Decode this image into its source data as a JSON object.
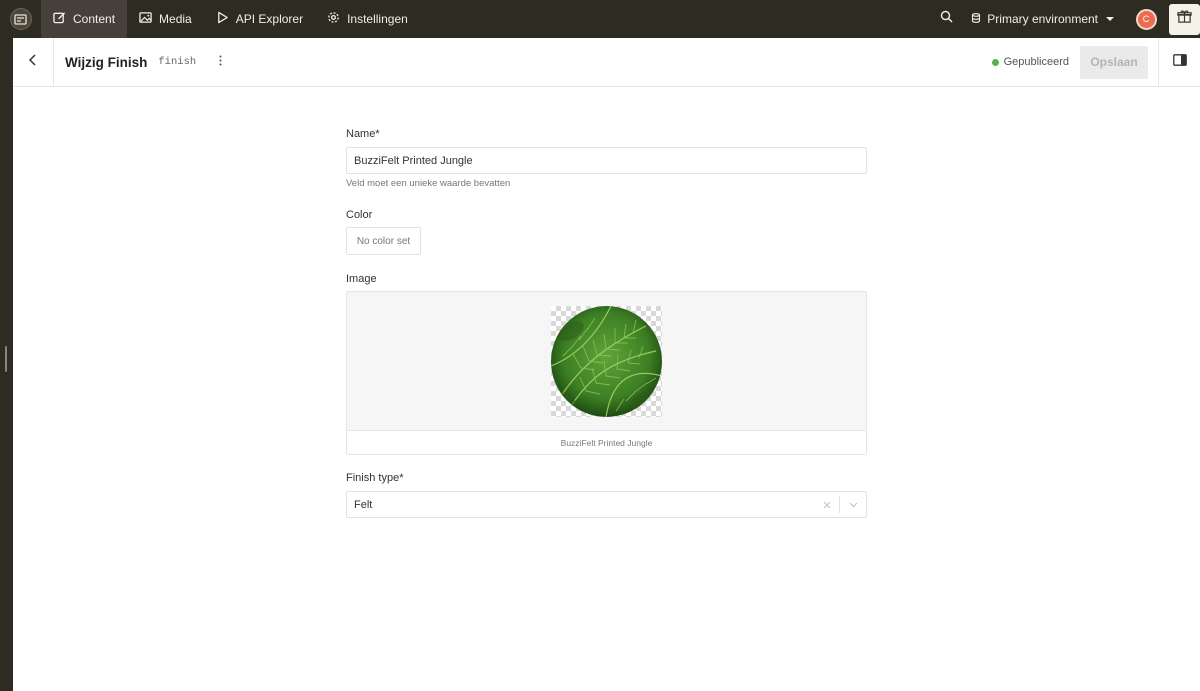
{
  "nav": {
    "items": [
      {
        "label": "Content",
        "icon": "edit-icon",
        "active": true
      },
      {
        "label": "Media",
        "icon": "image-icon"
      },
      {
        "label": "API Explorer",
        "icon": "play-icon"
      },
      {
        "label": "Instellingen",
        "icon": "gear-icon"
      }
    ],
    "environment": "Primary environment",
    "avatar_initial": "C"
  },
  "header": {
    "title": "Wijzig Finish",
    "api_key": "finish",
    "status": "Gepubliceerd",
    "save_label": "Opslaan"
  },
  "form": {
    "name": {
      "label": "Name*",
      "value": "BuzziFelt Printed Jungle",
      "hint": "Veld moet een unieke waarde bevatten"
    },
    "color": {
      "label": "Color",
      "button": "No color set"
    },
    "image": {
      "label": "Image",
      "caption": "BuzziFelt Printed Jungle"
    },
    "finish_type": {
      "label": "Finish type*",
      "value": "Felt"
    }
  },
  "colors": {
    "topbar": "#2e2b22",
    "active_nav": "#45413a",
    "published": "#53b34a",
    "avatar": "#ea6d4d"
  }
}
